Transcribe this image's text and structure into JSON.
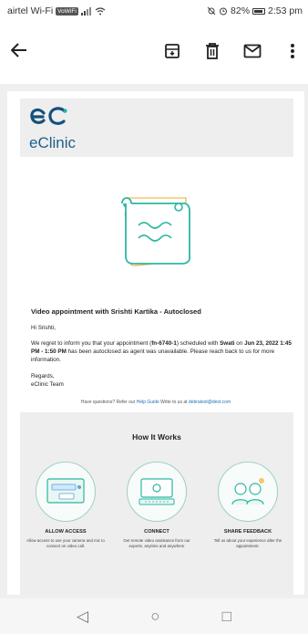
{
  "status_bar": {
    "carrier": "airtel Wi-Fi",
    "volte": "VoWiFi",
    "battery": "82%",
    "time": "2:53 pm"
  },
  "toolbar": {
    "back_icon": "arrow-left-icon",
    "actions": [
      "archive-icon",
      "delete-icon",
      "mail-icon",
      "more-vert-icon"
    ]
  },
  "brand": {
    "logo_text": "eC",
    "name": "eClinic",
    "accent": "#1f5f8c",
    "logo_color": "#15507d"
  },
  "email": {
    "subject": "Video appointment with Srishti Kartika - Autoclosed",
    "greeting": "Hi Srishti,",
    "body_1": "We regret to inform you that your appointment (",
    "appointment_id": "fn-6740-1",
    "body_2": ") scheduled with ",
    "agent": "Swati",
    "body_3": " on ",
    "date_time": "Jun 23, 2022 1:45 PM - 1:50 PM",
    "body_4": " has been autoclosed as agent was unavailable. Please reach back to us for more information.",
    "regards": "Regards,",
    "signature": "eClinic Team",
    "help_prefix": "Have questions? Refer our ",
    "help_link": "Help Guide",
    "help_mid": " Write to us at ",
    "help_email": "debratest@dest.com"
  },
  "how_it_works": {
    "title": "How It Works",
    "steps": [
      {
        "title": "ALLOW ACCESS",
        "desc": "Allow access to use your camera and mic to connect on video call."
      },
      {
        "title": "CONNECT",
        "desc": "Get remote video assistance from our experts, anytime and anywhere"
      },
      {
        "title": "SHARE FEEDBACK",
        "desc": "Tell us about your experience after the appointment."
      }
    ]
  },
  "nav": {
    "back": "◁",
    "home": "○",
    "recents": "□"
  }
}
